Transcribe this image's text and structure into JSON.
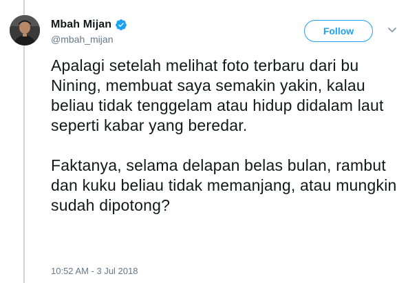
{
  "tweet": {
    "author": {
      "display_name": "Mbah Mijan",
      "username": "@mbah_mijan",
      "verified": true,
      "avatar_icon": "user-avatar-icon"
    },
    "follow_label": "Follow",
    "menu_icon": "chevron-down-icon",
    "paragraphs": [
      "Apalagi setelah melihat foto terbaru dari bu Nining, membuat saya semakin yakin, kalau beliau tidak tenggelam atau hidup didalam laut seperti kabar yang beredar.",
      "Faktanya, selama delapan belas bulan, rambut dan kuku beliau tidak memanjang, atau mungkin sudah dipotong?"
    ],
    "timestamp": "10:52 AM - 3 Jul 2018"
  },
  "colors": {
    "accent": "#1da1f2",
    "text": "#14171a",
    "muted": "#657786",
    "thread_line": "#ccd6dd"
  }
}
